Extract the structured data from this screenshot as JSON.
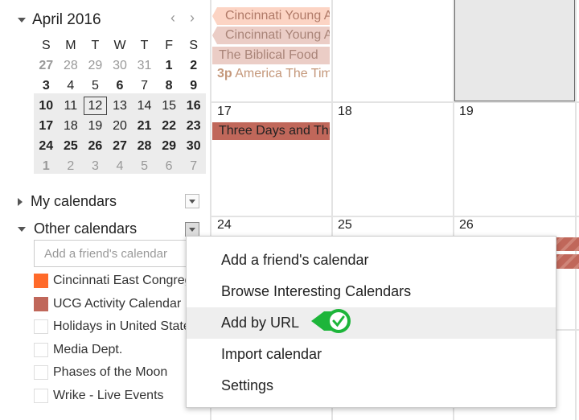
{
  "mini_calendar": {
    "title": "April 2016",
    "prev": "‹",
    "next": "›",
    "weekdays": [
      "S",
      "M",
      "T",
      "W",
      "T",
      "F",
      "S"
    ],
    "weeks": [
      [
        {
          "d": "27",
          "s": "gb"
        },
        {
          "d": "28",
          "s": "g"
        },
        {
          "d": "29",
          "s": "g"
        },
        {
          "d": "30",
          "s": "g"
        },
        {
          "d": "31",
          "s": "g"
        },
        {
          "d": "1",
          "s": "b"
        },
        {
          "d": "2",
          "s": "b"
        }
      ],
      [
        {
          "d": "3",
          "s": "b"
        },
        {
          "d": "4",
          "s": ""
        },
        {
          "d": "5",
          "s": ""
        },
        {
          "d": "6",
          "s": "b"
        },
        {
          "d": "7",
          "s": ""
        },
        {
          "d": "8",
          "s": "b"
        },
        {
          "d": "9",
          "s": "b"
        }
      ],
      [
        {
          "d": "10",
          "s": "b"
        },
        {
          "d": "11",
          "s": ""
        },
        {
          "d": "12",
          "s": "today"
        },
        {
          "d": "13",
          "s": ""
        },
        {
          "d": "14",
          "s": ""
        },
        {
          "d": "15",
          "s": ""
        },
        {
          "d": "16",
          "s": "b"
        }
      ],
      [
        {
          "d": "17",
          "s": "b"
        },
        {
          "d": "18",
          "s": ""
        },
        {
          "d": "19",
          "s": ""
        },
        {
          "d": "20",
          "s": ""
        },
        {
          "d": "21",
          "s": "b"
        },
        {
          "d": "22",
          "s": "b"
        },
        {
          "d": "23",
          "s": "b"
        }
      ],
      [
        {
          "d": "24",
          "s": "b"
        },
        {
          "d": "25",
          "s": "b"
        },
        {
          "d": "26",
          "s": "b"
        },
        {
          "d": "27",
          "s": "b"
        },
        {
          "d": "28",
          "s": "b"
        },
        {
          "d": "29",
          "s": "b"
        },
        {
          "d": "30",
          "s": "b"
        }
      ],
      [
        {
          "d": "1",
          "s": "gb"
        },
        {
          "d": "2",
          "s": "g"
        },
        {
          "d": "3",
          "s": "g"
        },
        {
          "d": "4",
          "s": "g"
        },
        {
          "d": "5",
          "s": "g"
        },
        {
          "d": "6",
          "s": "g"
        },
        {
          "d": "7",
          "s": "g"
        }
      ]
    ]
  },
  "sidebar": {
    "my_calendars": "My calendars",
    "other_calendars": "Other calendars",
    "friend_placeholder": "Add a friend's calendar",
    "calendars": [
      {
        "label": "Cincinnati East Congregation",
        "color": "#ff6a2a",
        "checked": true
      },
      {
        "label": "UCG Activity Calendar",
        "color": "#c0675a",
        "checked": true
      },
      {
        "label": "Holidays in United States",
        "color": "",
        "checked": false
      },
      {
        "label": "Media Dept.",
        "color": "",
        "checked": false
      },
      {
        "label": "Phases of the Moon",
        "color": "",
        "checked": false
      },
      {
        "label": "Wrike - Live Events",
        "color": "",
        "checked": false
      }
    ]
  },
  "month_grid": {
    "days": {
      "d17": "17",
      "d18": "18",
      "d19": "19",
      "d24": "24",
      "d25": "25",
      "d26": "26"
    },
    "events": {
      "e1": "Cincinnati Young Adults",
      "e2": "Cincinnati Young Adults",
      "e3": "The Biblical Food",
      "e4_time": "3p",
      "e4": "America The Time",
      "e5": "Three Days and Three Nights"
    }
  },
  "menu": {
    "items": [
      "Add a friend's calendar",
      "Browse Interesting Calendars",
      "Add by URL",
      "Import calendar",
      "Settings"
    ],
    "highlighted": "Add by URL"
  },
  "colors": {
    "accent_green": "#1db53a",
    "event_red": "#c0675a",
    "event_orange_light": "#fcd4c4"
  }
}
